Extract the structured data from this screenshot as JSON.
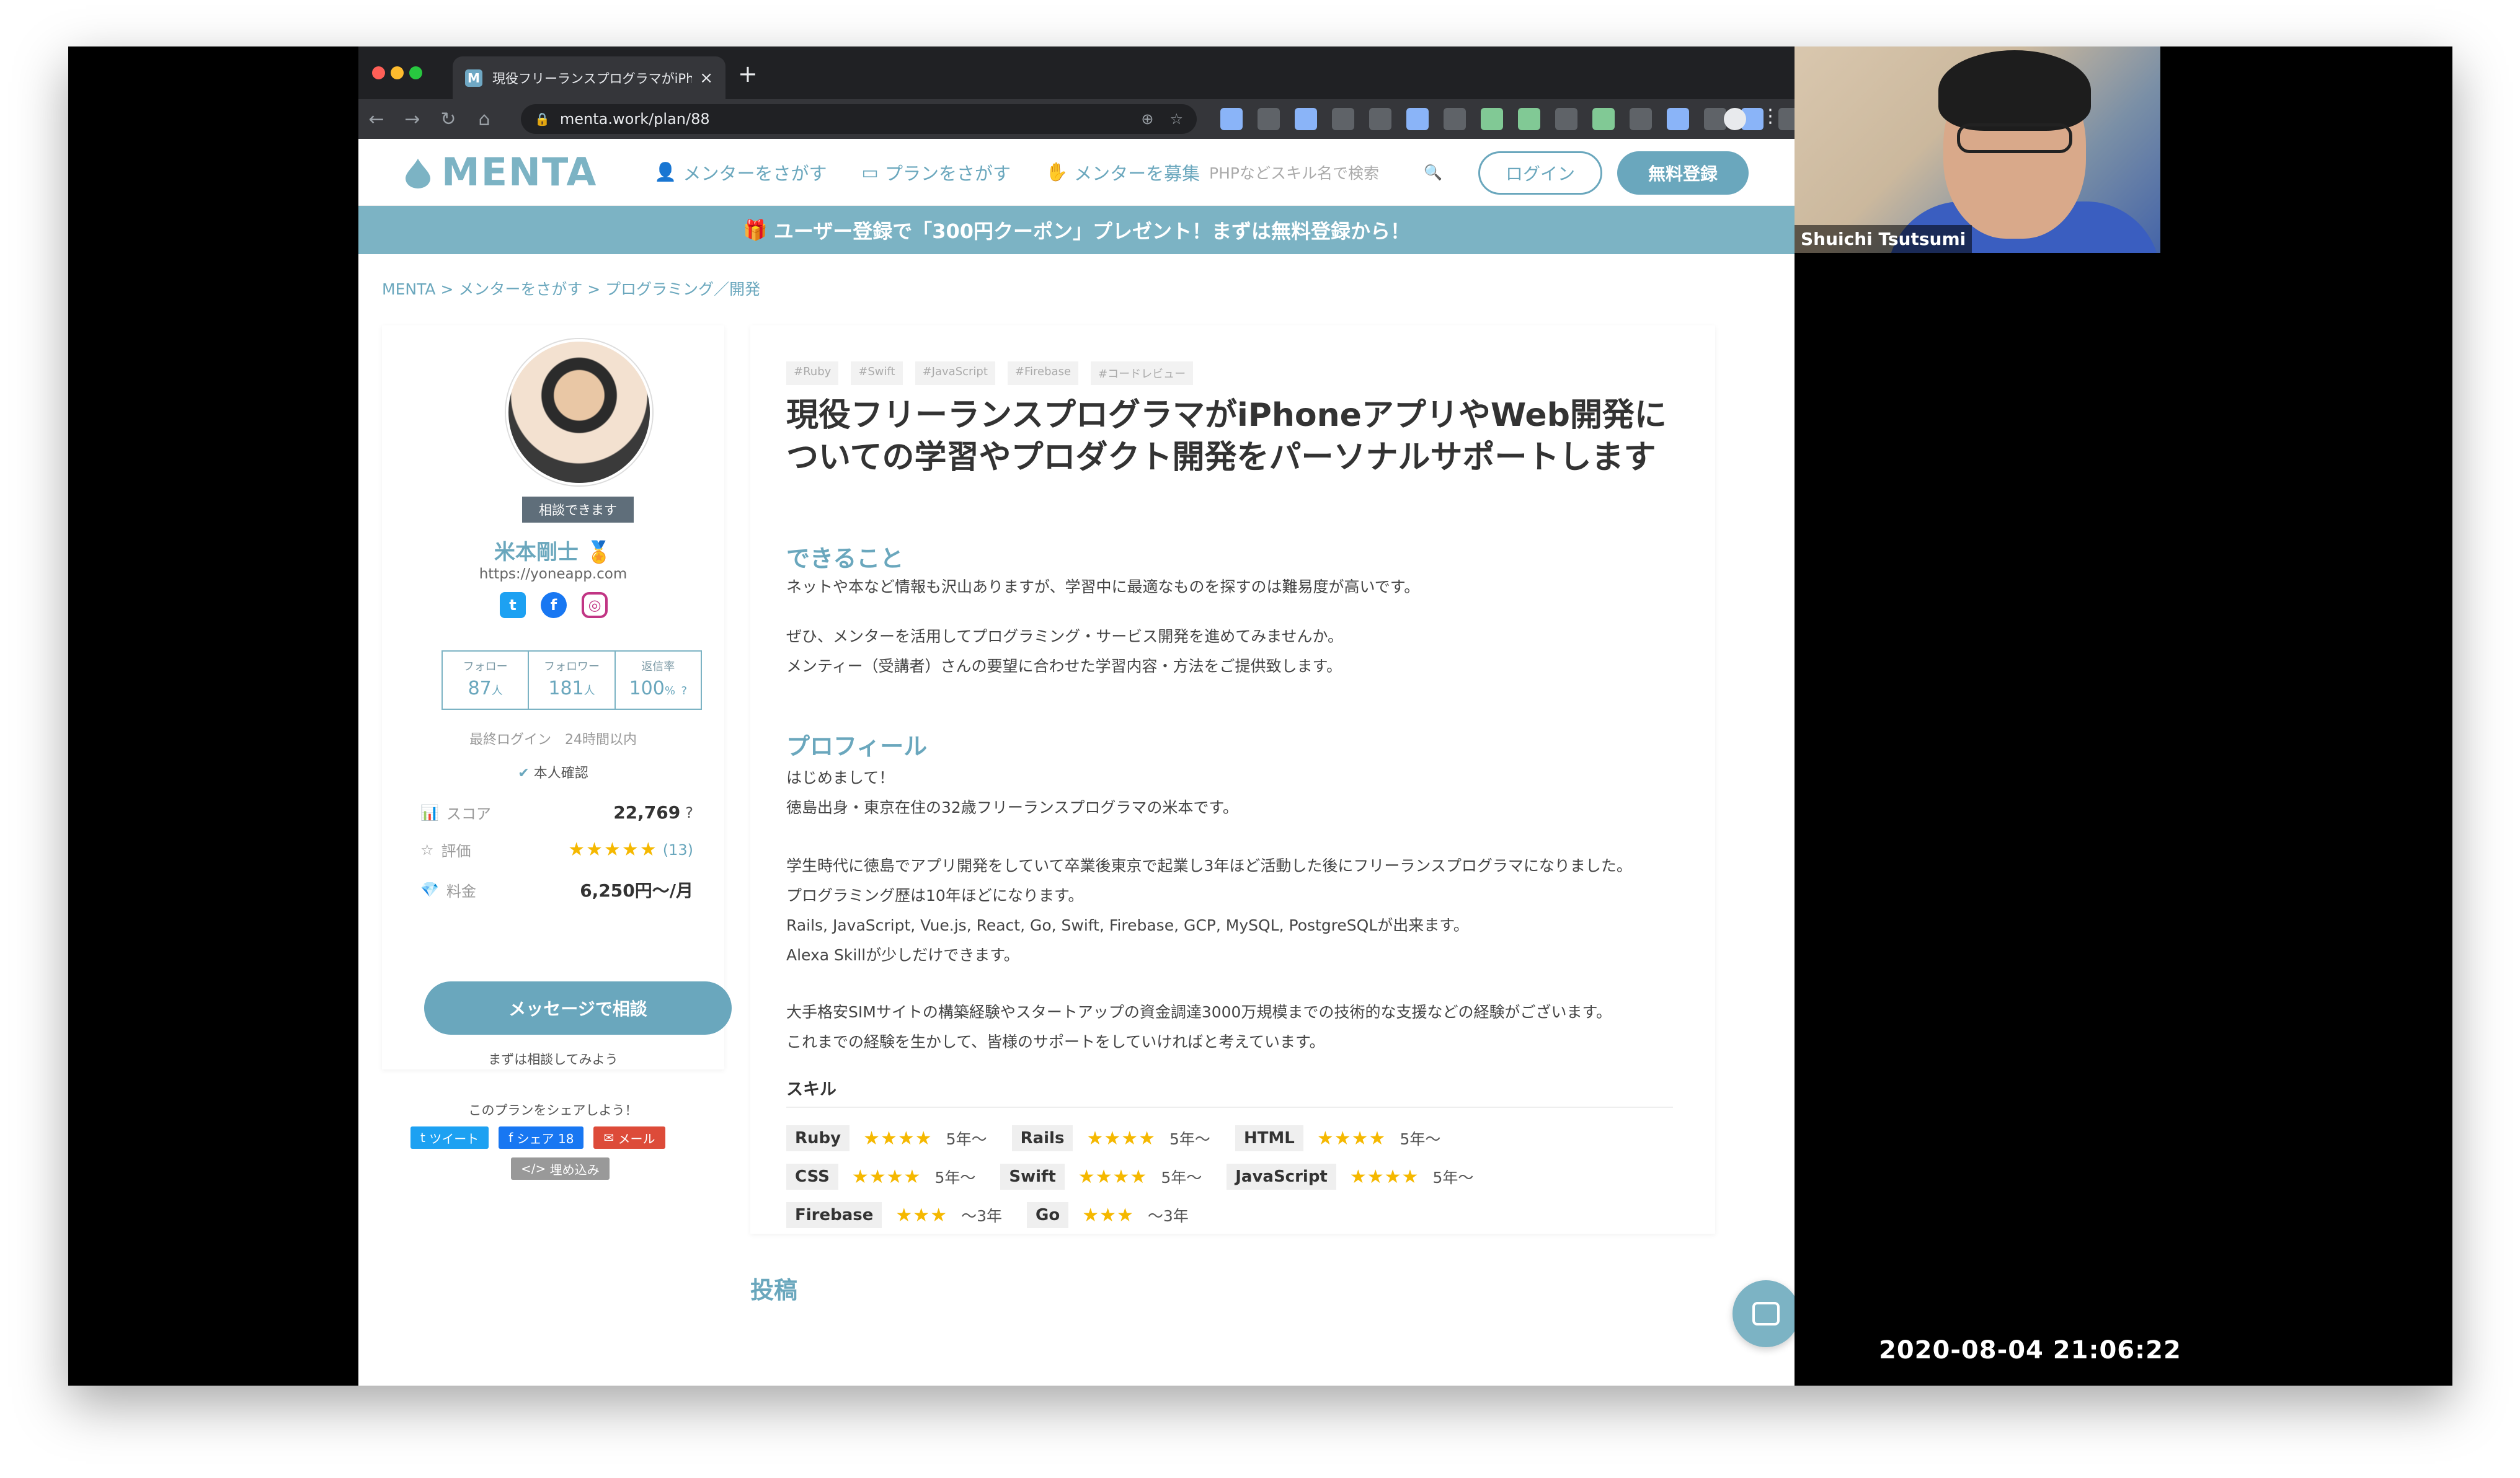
{
  "browser": {
    "tab_title": "現役フリーランスプログラマがiPh",
    "tab_favicon": "M",
    "url": "menta.work/plan/88"
  },
  "header": {
    "logo": "MENTA",
    "nav": [
      {
        "label": "メンターをさがす",
        "icon": "person-icon"
      },
      {
        "label": "プランをさがす",
        "icon": "monitor-icon"
      },
      {
        "label": "メンターを募集",
        "icon": "hand-icon"
      }
    ],
    "search_placeholder": "PHPなどスキル名で検索",
    "login_label": "ログイン",
    "signup_label": "無料登録"
  },
  "banner": {
    "text": "ユーザー登録で「300円クーポン」プレゼント！まずは無料登録から！"
  },
  "breadcrumb": "MENTA > メンターをさがす > プログラミング／開発",
  "mentor": {
    "badge": "相談できます",
    "name": "米本剛士",
    "url": "https://yoneapp.com",
    "stats": [
      {
        "label": "フォロー",
        "value": "87",
        "unit": "人"
      },
      {
        "label": "フォロワー",
        "value": "181",
        "unit": "人"
      },
      {
        "label": "返信率",
        "value": "100",
        "unit": "%"
      }
    ],
    "last_login_label": "最終ログイン",
    "last_login_value": "24時間以内",
    "verified": "本人確認",
    "score_label": "スコア",
    "score_value": "22,769",
    "rating_label": "評価",
    "rating_stars": "★★★★★",
    "rating_count": "(13)",
    "price_label": "料金",
    "price_value": "6,250円〜/月",
    "message_button": "メッセージで相談",
    "message_sub": "まずは相談してみよう"
  },
  "share": {
    "title": "このプランをシェアしよう！",
    "tweet": "ツイート",
    "facebook": "シェア 18",
    "mail": "メール",
    "embed": "埋め込み"
  },
  "plan": {
    "tags": [
      "#Ruby",
      "#Swift",
      "#JavaScript",
      "#Firebase",
      "#コードレビュー"
    ],
    "title": "現役フリーランスプログラマがiPhoneアプリやWeb開発についての学習やプロダクト開発をパーソナルサポートします",
    "can_do_heading": "できること",
    "can_do_1": "ネットや本など情報も沢山ありますが、学習中に最適なものを探すのは難易度が高いです。",
    "can_do_2": "ぜひ、メンターを活用してプログラミング・サービス開発を進めてみませんか。",
    "can_do_3": "メンティー（受講者）さんの要望に合わせた学習内容・方法をご提供致します。",
    "profile_heading": "プロフィール",
    "profile_1": "はじめまして！",
    "profile_2": "徳島出身・東京在住の32歳フリーランスプログラマの米本です。",
    "profile_3": "学生時代に徳島でアプリ開発をしていて卒業後東京で起業し3年ほど活動した後にフリーランスプログラマになりました。",
    "profile_4": "プログラミング歴は10年ほどになります。",
    "profile_5": "Rails, JavaScript, Vue.js, React, Go, Swift, Firebase, GCP, MySQL, PostgreSQLが出来ます。",
    "profile_6": "Alexa Skillが少しだけできます。",
    "profile_7": "大手格安SIMサイトの構築経験やスタートアップの資金調達3000万規模までの技術的な支援などの経験がございます。",
    "profile_8": "これまでの経験を生かして、皆様のサポートをしていければと考えています。",
    "skills_heading": "スキル",
    "skills": [
      {
        "name": "Ruby",
        "stars": "★★★★",
        "years": "5年〜"
      },
      {
        "name": "Rails",
        "stars": "★★★★",
        "years": "5年〜"
      },
      {
        "name": "HTML",
        "stars": "★★★★",
        "years": "5年〜"
      },
      {
        "name": "CSS",
        "stars": "★★★★",
        "years": "5年〜"
      },
      {
        "name": "Swift",
        "stars": "★★★★",
        "years": "5年〜"
      },
      {
        "name": "JavaScript",
        "stars": "★★★★",
        "years": "5年〜"
      },
      {
        "name": "Firebase",
        "stars": "★★★",
        "years": "〜3年"
      },
      {
        "name": "Go",
        "stars": "★★★",
        "years": "〜3年"
      }
    ]
  },
  "posts_heading": "投稿",
  "video": {
    "participant": "Shuichi Tsutsumi"
  },
  "timestamp": "2020-08-04 21:06:22",
  "colors": {
    "brand": "#6aa7bd",
    "banner": "#7cb3c4",
    "star": "#f5b800"
  }
}
